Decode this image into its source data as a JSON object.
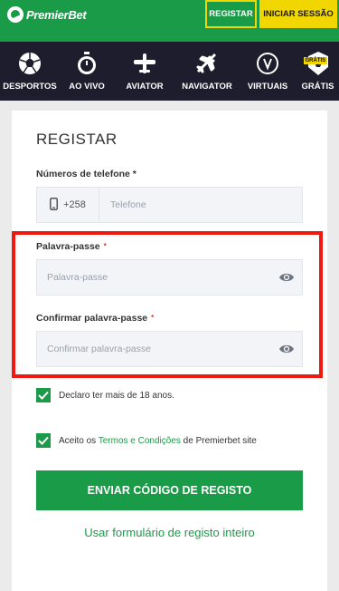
{
  "header": {
    "brand": "PremierBet",
    "register_label": "REGISTAR",
    "login_label": "INICIAR SESSÃO",
    "brand_color": "#1a9b48",
    "accent_color": "#f2d600"
  },
  "nav": {
    "items": [
      {
        "label": "DESPORTOS",
        "icon": "soccer-ball-icon"
      },
      {
        "label": "AO VIVO",
        "icon": "stopwatch-icon"
      },
      {
        "label": "AVIATOR",
        "icon": "propeller-plane-icon"
      },
      {
        "label": "NAVIGATOR",
        "icon": "airplane-icon"
      },
      {
        "label": "VIRTUAIS",
        "icon": "virtual-v-icon"
      },
      {
        "label": "GRÁTIS",
        "icon": "gift-badge-icon",
        "badge": "GRÁTIS"
      }
    ]
  },
  "form": {
    "title": "REGISTAR",
    "phone": {
      "label": "Números de telefone *",
      "prefix": "+258",
      "placeholder": "Telefone"
    },
    "password": {
      "label": "Palavra-passe",
      "placeholder": "Palavra-passe"
    },
    "confirm_password": {
      "label": "Confirmar palavra-passe",
      "placeholder": "Confirmar palavra-passe"
    },
    "required_mark": "*",
    "age_check": {
      "label": "Declaro ter mais de 18 anos.",
      "checked": true
    },
    "terms_check": {
      "prefix": "Aceito os ",
      "link": "Termos e Condições",
      "suffix": " de Premierbet site",
      "checked": true
    },
    "submit_label": "ENVIAR CÓDIGO DE REGISTO",
    "full_form_link": "Usar formulário de registo inteiro"
  }
}
